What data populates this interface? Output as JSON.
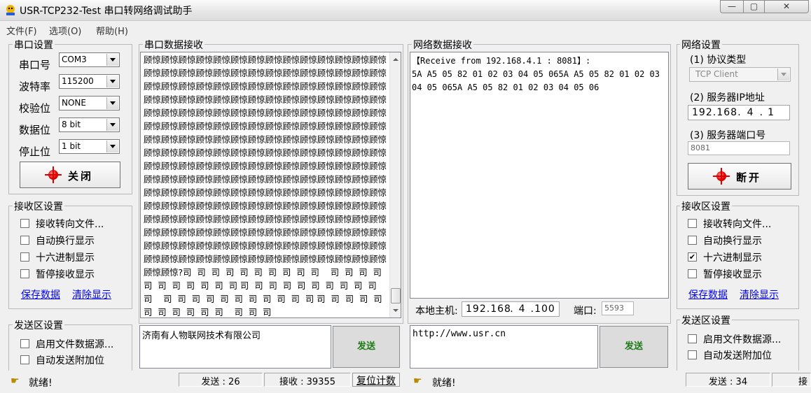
{
  "window": {
    "title": "USR-TCP232-Test 串口转网络调试助手",
    "min_label": "—",
    "max_label": "▢",
    "close_label": "✕"
  },
  "menu": [
    "文件(F)",
    "选项(O)",
    "帮助(H)"
  ],
  "serial_settings": {
    "group_label": "串口设置",
    "port_label": "串口号",
    "port_value": "COM3",
    "baud_label": "波特率",
    "baud_value": "115200",
    "parity_label": "校验位",
    "parity_value": "NONE",
    "databits_label": "数据位",
    "databits_value": "8 bit",
    "stopbits_label": "停止位",
    "stopbits_value": "1 bit",
    "toggle_label": "关闭"
  },
  "serial_receive_settings": {
    "group_label": "接收区设置",
    "options": [
      {
        "label": "接收转向文件...",
        "checked": false
      },
      {
        "label": "自动换行显示",
        "checked": false
      },
      {
        "label": "十六进制显示",
        "checked": false
      },
      {
        "label": "暂停接收显示",
        "checked": false
      }
    ],
    "save_label": "保存数据",
    "clear_label": "清除显示"
  },
  "serial_send_settings": {
    "group_label": "发送区设置",
    "options": [
      {
        "label": "启用文件数据源...",
        "checked": false
      },
      {
        "label": "自动发送附加位",
        "checked": false
      }
    ]
  },
  "serial_data": {
    "group_label": "串口数据接收",
    "received_text": "顾惊顾惊顾惊顾惊顾惊顾惊顾惊顾惊顾惊顾惊顾惊顾惊顾惊顾惊顾惊顾惊顾惊顾惊顾惊顾惊顾惊顾惊顾惊顾惊顾惊顾惊顾惊顾惊顾惊顾惊顾惊顾惊顾惊顾惊顾惊顾惊顾惊顾惊顾惊顾惊顾惊顾惊顾惊顾惊顾惊顾惊顾惊顾惊顾惊顾惊顾惊顾惊顾惊顾惊顾惊顾惊顾惊顾惊顾惊顾惊顾惊顾惊顾惊顾惊顾惊顾惊顾惊顾惊顾惊顾惊顾惊顾惊顾惊顾惊顾惊顾惊顾惊顾惊顾惊顾惊顾惊顾惊顾惊顾惊顾惊顾惊顾惊顾惊顾惊顾惊顾惊顾惊顾惊顾惊顾惊顾惊顾惊顾惊顾惊顾惊顾惊顾惊顾惊顾惊顾惊顾惊顾惊顾惊顾惊顾惊顾惊顾惊顾惊顾惊顾惊顾惊顾惊顾惊顾惊顾惊顾惊顾惊顾惊顾惊顾惊顾惊顾惊顾惊顾惊顾惊顾惊顾惊顾惊顾惊顾惊顾惊顾惊顾惊顾惊顾惊顾惊顾惊顾惊顾惊顾惊顾惊顾惊顾惊顾惊顾惊顾惊顾惊顾惊顾惊顾惊顾惊顾惊顾惊顾惊顾惊顾惊顾惊顾惊顾惊顾惊顾惊顾惊顾惊顾惊顾惊顾惊顾惊顾惊顾惊顾惊顾惊顾惊顾惊顾惊顾惊顾惊顾惊顾惊顾惊顾惊顾惊顾惊顾惊顾惊顾惊顾惊顾惊顾惊顾惊顾惊顾惊顾惊顾惊顾惊顾惊顾惊顾惊顾惊顾惊顾惊顾惊顾惊顾惊顾惊顾惊顾惊顾惊顾惊顾惊顾惊顾惊顾惊顾惊顾惊顾惊顾惊顾惊顾惊顾惊顾惊顾惊?司  司  司  司  司  司  司  司  司  司    司  司  司  司  司  司  司  司  司  司  司 司  司  司  司  司  司  司  司  司  司  司    司  司  司  司  司  司  司  司  司  司  司 司  司  司  司  司  司  司  司  司  司  司    司  司  司",
    "send_text": "济南有人物联网技术有限公司",
    "send_label": "发送"
  },
  "network_data": {
    "group_label": "网络数据接收",
    "received_text": "【Receive from 192.168.4.1 : 8081】:\n5A A5 05 82 01 02 03 04 05 065A A5 05 82 01 02 03 04 05 065A A5 05 82 01 02 03 04 05 06",
    "local_host_label": "本地主机:",
    "local_ip": [
      "192",
      "168",
      "4",
      "100"
    ],
    "port_label": "端口:",
    "port_value": "5593",
    "send_text": "http://www.usr.cn",
    "send_label": "发送"
  },
  "network_settings": {
    "group_label": "网络设置",
    "protocol_label": "(1) 协议类型",
    "protocol_value": "TCP Client",
    "ip_label": "(2) 服务器IP地址",
    "server_ip": [
      "192",
      "168",
      "4",
      "1"
    ],
    "port_label": "(3) 服务器端口号",
    "port_value": "8081",
    "toggle_label": "断开"
  },
  "network_receive_settings": {
    "group_label": "接收区设置",
    "options": [
      {
        "label": "接收转向文件...",
        "checked": false
      },
      {
        "label": "自动换行显示",
        "checked": false
      },
      {
        "label": "十六进制显示",
        "checked": true
      },
      {
        "label": "暂停接收显示",
        "checked": false
      }
    ],
    "save_label": "保存数据",
    "clear_label": "清除显示"
  },
  "network_send_settings": {
    "group_label": "发送区设置",
    "options": [
      {
        "label": "启用文件数据源...",
        "checked": false
      },
      {
        "label": "自动发送附加位",
        "checked": false
      }
    ]
  },
  "status": {
    "serial_ready": "就绪!",
    "serial_sent": "发送 : 26",
    "serial_received": "接收 : 39355",
    "reset_label": "复位计数",
    "network_ready": "就绪!",
    "network_sent": "发送 : 34",
    "network_received_partial": "接"
  }
}
